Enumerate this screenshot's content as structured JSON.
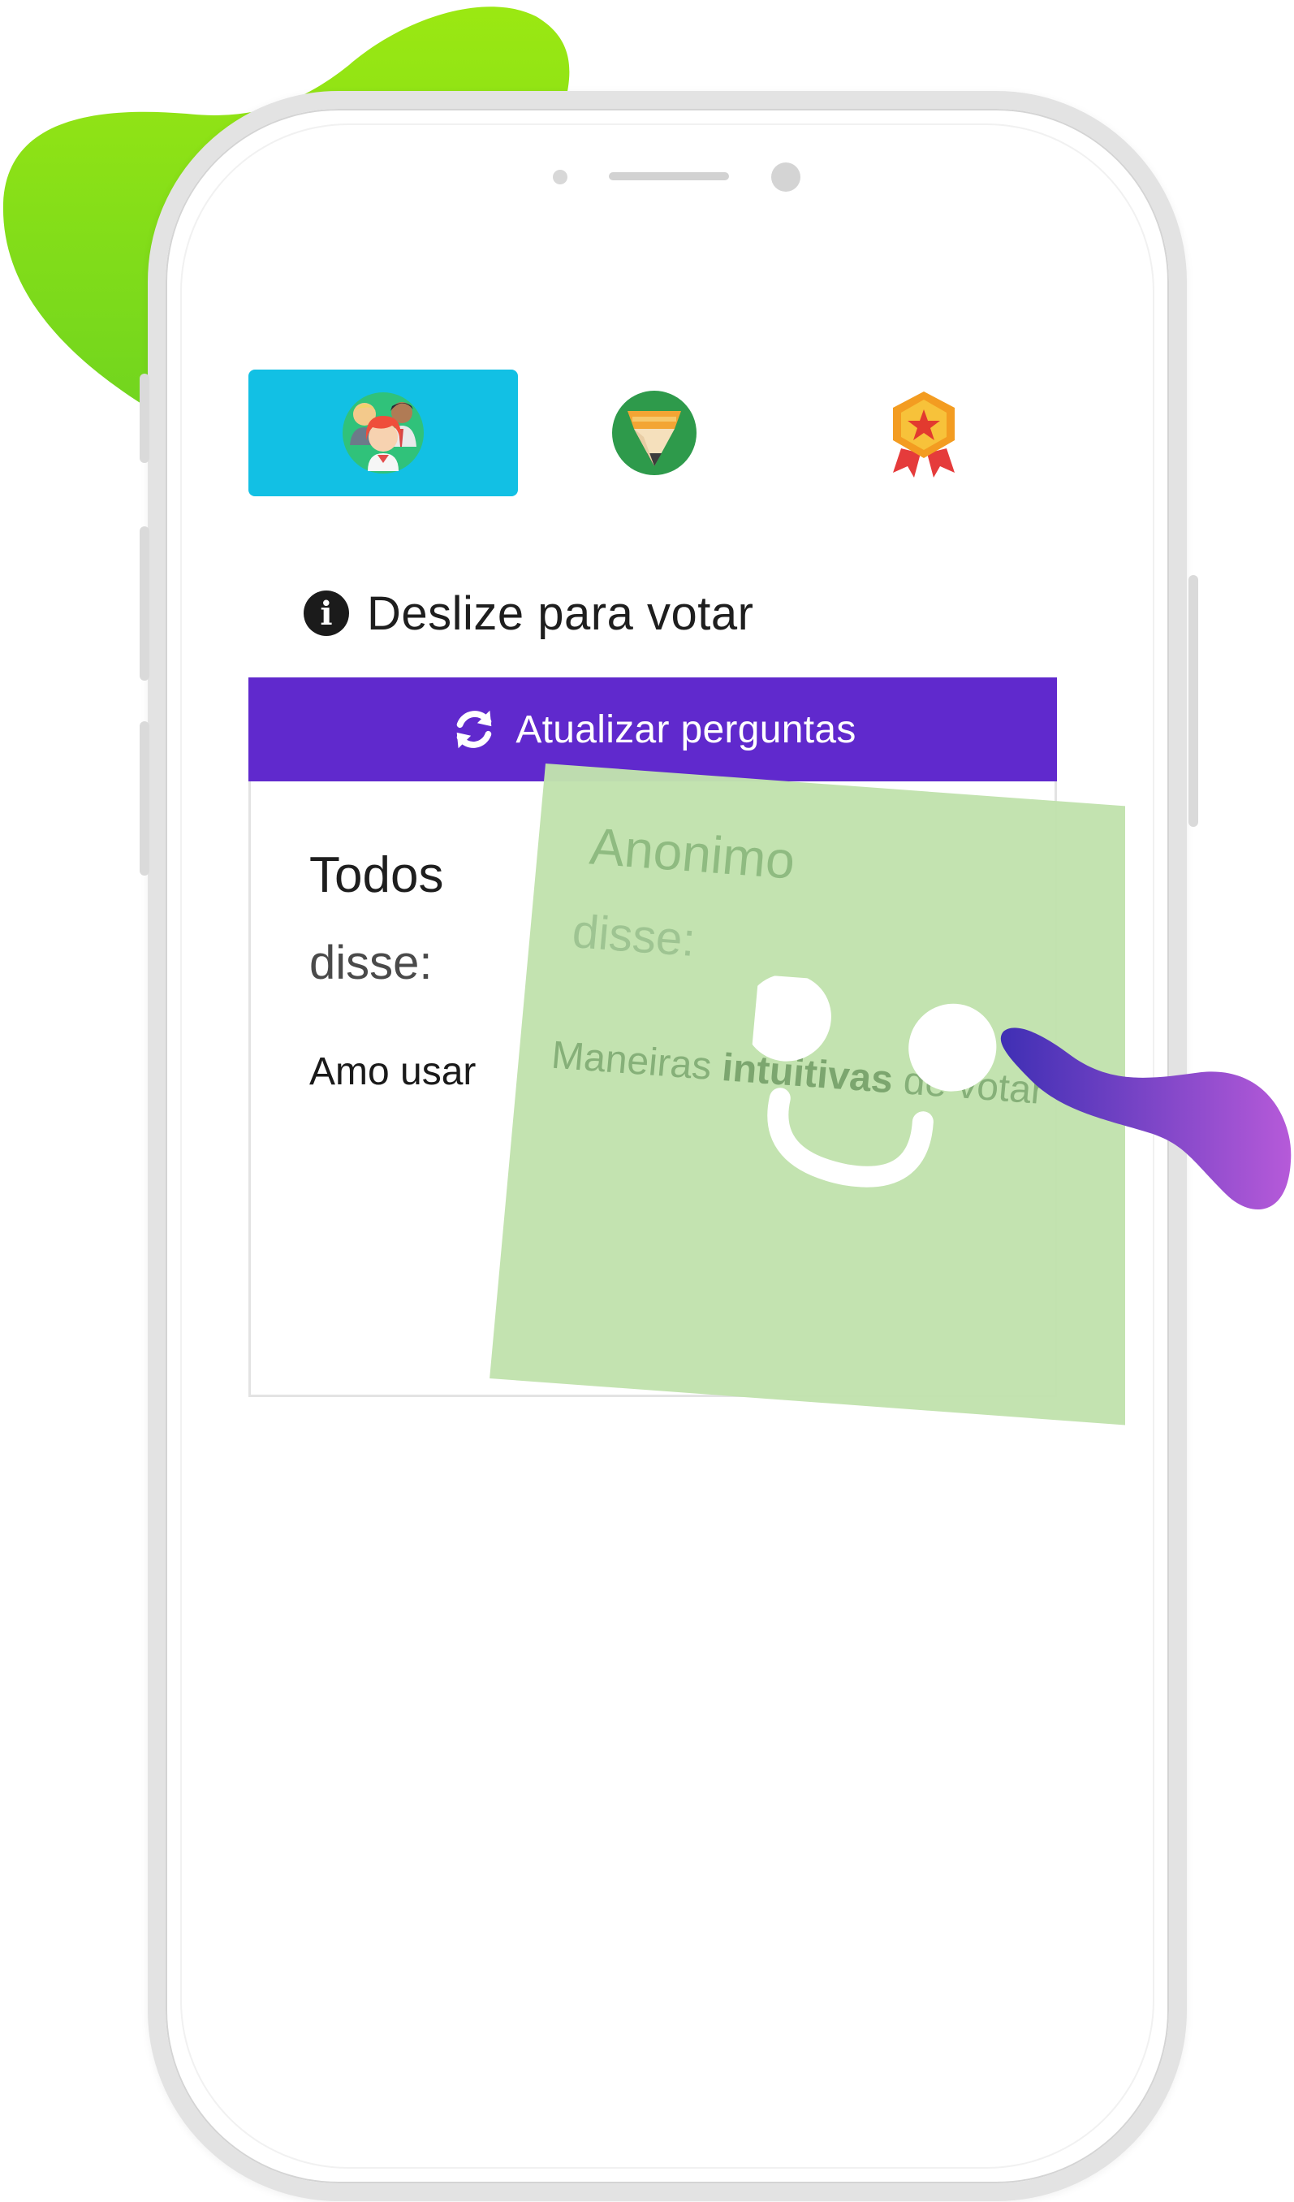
{
  "tabs": [
    {
      "name": "community",
      "icon": "community-people-icon",
      "active": true
    },
    {
      "name": "pencil",
      "icon": "pencil-icon",
      "active": false
    },
    {
      "name": "medal",
      "icon": "medal-icon",
      "active": false
    }
  ],
  "info": {
    "icon": "info-icon",
    "text": "Deslize para votar"
  },
  "refresh": {
    "icon": "refresh-icon",
    "label": "Atualizar perguntas"
  },
  "card": {
    "author": "Todos",
    "said": "disse:",
    "text": "Amo usar"
  },
  "swipe_card": {
    "author": "Anonimo",
    "said": "disse:",
    "text_before": "Maneiras ",
    "text_bold": "intuitivas",
    "text_after": " de votar"
  },
  "colors": {
    "tab_active": "#12c0e4",
    "refresh_bar": "#6029cd",
    "swipe_card": "#c1e2ad",
    "blob_green": "#8ee21a",
    "swoosh_purple": "#7a3fd1"
  }
}
